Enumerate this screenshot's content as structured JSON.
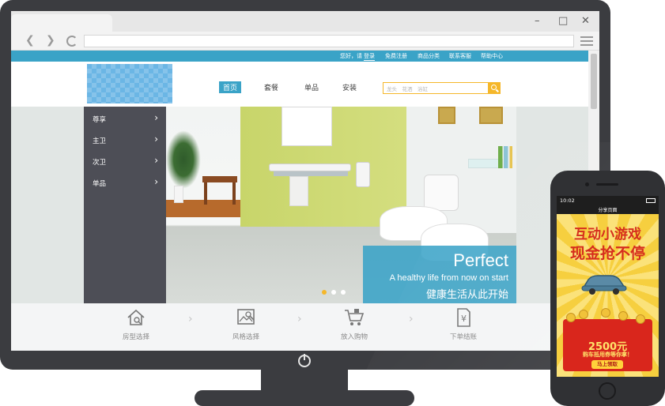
{
  "colors": {
    "brand": "#3aa3c7",
    "accent": "#f5b72a",
    "sidenav": "#4d4e56",
    "device": "#3b3c40"
  },
  "browser": {
    "controls": {
      "minimize": "–",
      "maximize": "□",
      "close": "✕"
    },
    "icons": [
      "back-icon",
      "forward-icon",
      "reload-icon",
      "menu-icon"
    ]
  },
  "topbar": {
    "greeting": "您好，请",
    "login": "登录",
    "links": [
      "免费注册",
      "商品分类",
      "联系客服",
      "帮助中心"
    ]
  },
  "mainnav": {
    "items": [
      "首页",
      "套餐",
      "单品",
      "安装"
    ],
    "active_index": 0
  },
  "search": {
    "placeholder": "龙头　花洒　浴缸"
  },
  "sidenav": {
    "items": [
      "尊享",
      "主卫",
      "次卫",
      "单品"
    ]
  },
  "banner": {
    "title": "Perfect",
    "subtitle_en": "A healthy life from now on start",
    "subtitle_cn": "健康生活从此开始",
    "slides": 3,
    "active_slide": 0
  },
  "steps": [
    {
      "label": "房型选择",
      "icon": "house-search-icon"
    },
    {
      "label": "风格选择",
      "icon": "picture-search-icon"
    },
    {
      "label": "放入购物",
      "icon": "cart-icon"
    },
    {
      "label": "下单结账",
      "icon": "yuan-bill-icon"
    }
  ],
  "phone": {
    "time": "10:02",
    "title": "分享页面",
    "game_line1": "互动小游戏",
    "game_line2": "现金抢不停",
    "amount": "2500元",
    "prize_text": "购车抵用券等你拿！",
    "cta": "马上领取"
  }
}
